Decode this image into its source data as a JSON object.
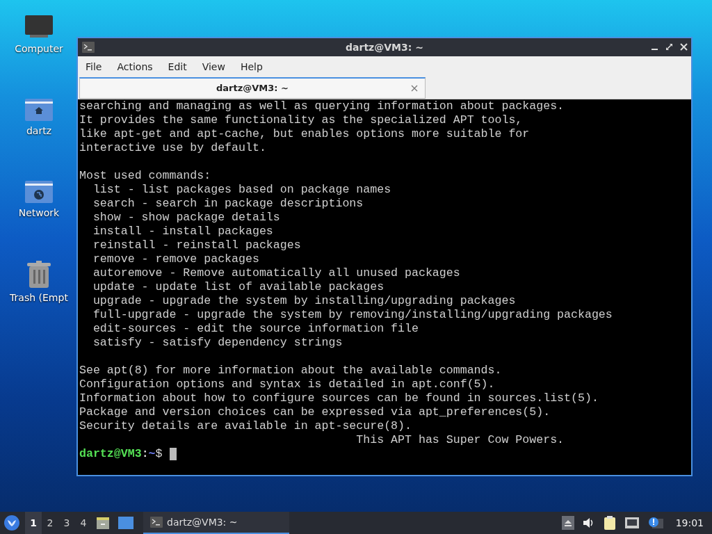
{
  "desktop_icons": [
    {
      "kind": "computer",
      "label": "Computer"
    },
    {
      "kind": "home",
      "label": "dartz"
    },
    {
      "kind": "network",
      "label": "Network"
    },
    {
      "kind": "trash",
      "label": "Trash (Empt"
    }
  ],
  "window": {
    "title": "dartz@VM3: ~",
    "menu": [
      "File",
      "Actions",
      "Edit",
      "View",
      "Help"
    ],
    "tabs": [
      {
        "label": "dartz@VM3: ~",
        "selected": true
      }
    ],
    "terminal": {
      "lines": [
        {
          "text": "searching and managing as well as querying information about packages."
        },
        {
          "text": "It provides the same functionality as the specialized APT tools,"
        },
        {
          "text": "like apt-get and apt-cache, but enables options more suitable for"
        },
        {
          "text": "interactive use by default."
        },
        {
          "text": "Most used commands:",
          "blank_before": true
        },
        {
          "text": "  list - list packages based on package names"
        },
        {
          "text": "  search - search in package descriptions"
        },
        {
          "text": "  show - show package details"
        },
        {
          "text": "  install - install packages"
        },
        {
          "text": "  reinstall - reinstall packages"
        },
        {
          "text": "  remove - remove packages"
        },
        {
          "text": "  autoremove - Remove automatically all unused packages"
        },
        {
          "text": "  update - update list of available packages"
        },
        {
          "text": "  upgrade - upgrade the system by installing/upgrading packages"
        },
        {
          "text": "  full-upgrade - upgrade the system by removing/installing/upgrading packages"
        },
        {
          "text": "  edit-sources - edit the source information file"
        },
        {
          "text": "  satisfy - satisfy dependency strings"
        },
        {
          "text": "See apt(8) for more information about the available commands.",
          "blank_before": true
        },
        {
          "text": "Configuration options and syntax is detailed in apt.conf(5)."
        },
        {
          "text": "Information about how to configure sources can be found in sources.list(5)."
        },
        {
          "text": "Package and version choices can be expressed via apt_preferences(5)."
        },
        {
          "text": "Security details are available in apt-secure(8)."
        },
        {
          "text": "                                        This APT has Super Cow Powers."
        }
      ],
      "prompt": {
        "user": "dartz@VM3",
        "separator": ":",
        "path": "~",
        "symbol": "$"
      }
    }
  },
  "taskbar": {
    "workspaces": [
      {
        "label": "1",
        "selected": true
      },
      {
        "label": "2",
        "selected": false
      },
      {
        "label": "3",
        "selected": false
      },
      {
        "label": "4",
        "selected": false
      }
    ],
    "tasks": [
      {
        "label": "dartz@VM3: ~"
      }
    ],
    "clock": "19:01"
  }
}
